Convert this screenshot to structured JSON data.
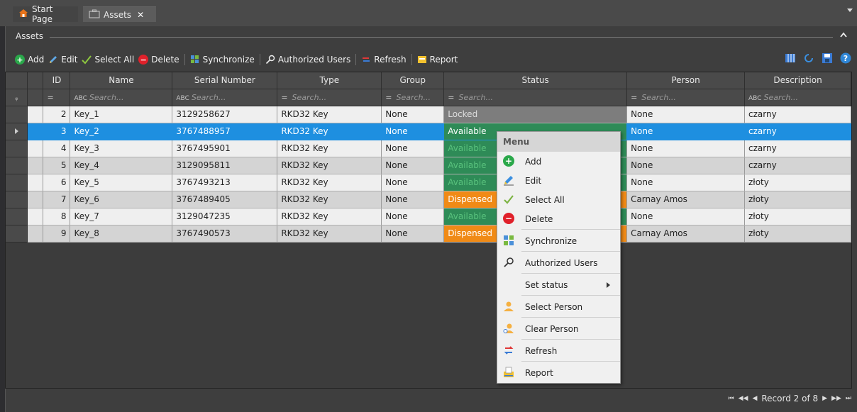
{
  "tabs": {
    "start": "Start Page",
    "assets": "Assets",
    "close": "✕"
  },
  "group": {
    "title": "Assets"
  },
  "toolbar": {
    "add": "Add",
    "edit": "Edit",
    "select_all": "Select All",
    "delete": "Delete",
    "synchronize": "Synchronize",
    "authorized_users": "Authorized Users",
    "refresh": "Refresh",
    "report": "Report"
  },
  "columns": [
    "ID",
    "Name",
    "Serial Number",
    "Type",
    "Group",
    "Status",
    "Person",
    "Description"
  ],
  "filter_placeholder": "Search...",
  "rows": [
    {
      "id": "2",
      "name": "Key_1",
      "serial": "3129258627",
      "type": "RKD32 Key",
      "group": "None",
      "status": "Locked",
      "person": "None",
      "description": "czarny"
    },
    {
      "id": "3",
      "name": "Key_2",
      "serial": "3767488957",
      "type": "RKD32 Key",
      "group": "None",
      "status": "Available",
      "person": "None",
      "description": "czarny"
    },
    {
      "id": "4",
      "name": "Key_3",
      "serial": "3767495901",
      "type": "RKD32 Key",
      "group": "None",
      "status": "Available",
      "person": "None",
      "description": "czarny"
    },
    {
      "id": "5",
      "name": "Key_4",
      "serial": "3129095811",
      "type": "RKD32 Key",
      "group": "None",
      "status": "Available",
      "person": "None",
      "description": "czarny"
    },
    {
      "id": "6",
      "name": "Key_5",
      "serial": "3767493213",
      "type": "RKD32 Key",
      "group": "None",
      "status": "Available",
      "person": "None",
      "description": "złoty"
    },
    {
      "id": "7",
      "name": "Key_6",
      "serial": "3767489405",
      "type": "RKD32 Key",
      "group": "None",
      "status": "Dispensed",
      "person": "Carnay Amos",
      "description": "złoty"
    },
    {
      "id": "8",
      "name": "Key_7",
      "serial": "3129047235",
      "type": "RKD32 Key",
      "group": "None",
      "status": "Available",
      "person": "None",
      "description": "złoty"
    },
    {
      "id": "9",
      "name": "Key_8",
      "serial": "3767490573",
      "type": "RKD32 Key",
      "group": "None",
      "status": "Dispensed",
      "person": "Carnay Amos",
      "description": "złoty"
    }
  ],
  "selected_row": 1,
  "pager": {
    "text": "Record 2 of 8"
  },
  "menu": {
    "header": "Menu",
    "items": [
      "Add",
      "Edit",
      "Select All",
      "Delete",
      "Synchronize",
      "Authorized Users",
      "Set status",
      "Select Person",
      "Clear Person",
      "Refresh",
      "Report"
    ]
  },
  "colors": {
    "selected": "#1e8fe0",
    "available": "#2e8b57",
    "dispensed": "#f08a16",
    "locked": "#7d7d7d"
  }
}
